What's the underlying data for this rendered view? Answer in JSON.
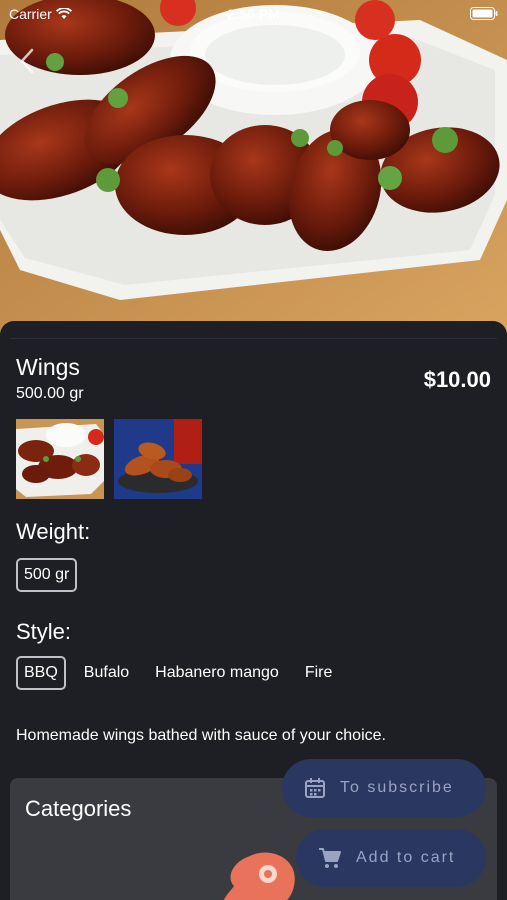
{
  "status_bar": {
    "carrier": "Carrier",
    "time": "2:56 PM"
  },
  "product": {
    "name": "Wings",
    "weight_text": "500.00 gr",
    "price": "$10.00",
    "description": "Homemade wings bathed with sauce of your choice."
  },
  "weight": {
    "label": "Weight:",
    "options": [
      "500 gr"
    ],
    "selected": "500 gr"
  },
  "style": {
    "label": "Style:",
    "options": [
      "BBQ",
      "Bufalo",
      "Habanero mango",
      "Fire"
    ],
    "selected": "BBQ"
  },
  "categories": {
    "title": "Categories"
  },
  "actions": {
    "subscribe_label": "To subscribe",
    "add_to_cart_label": "Add to cart"
  },
  "colors": {
    "background": "#1e1f24",
    "card": "#3a3b40",
    "fab": "#2a3761",
    "fab_text": "#9aa3c2",
    "category_icon": "#e8735a"
  },
  "icons": {
    "back": "chevron-left-icon",
    "wifi": "wifi-icon",
    "battery": "battery-icon",
    "subscribe": "calendar-icon",
    "cart": "cart-icon",
    "category": "meat-icon"
  }
}
